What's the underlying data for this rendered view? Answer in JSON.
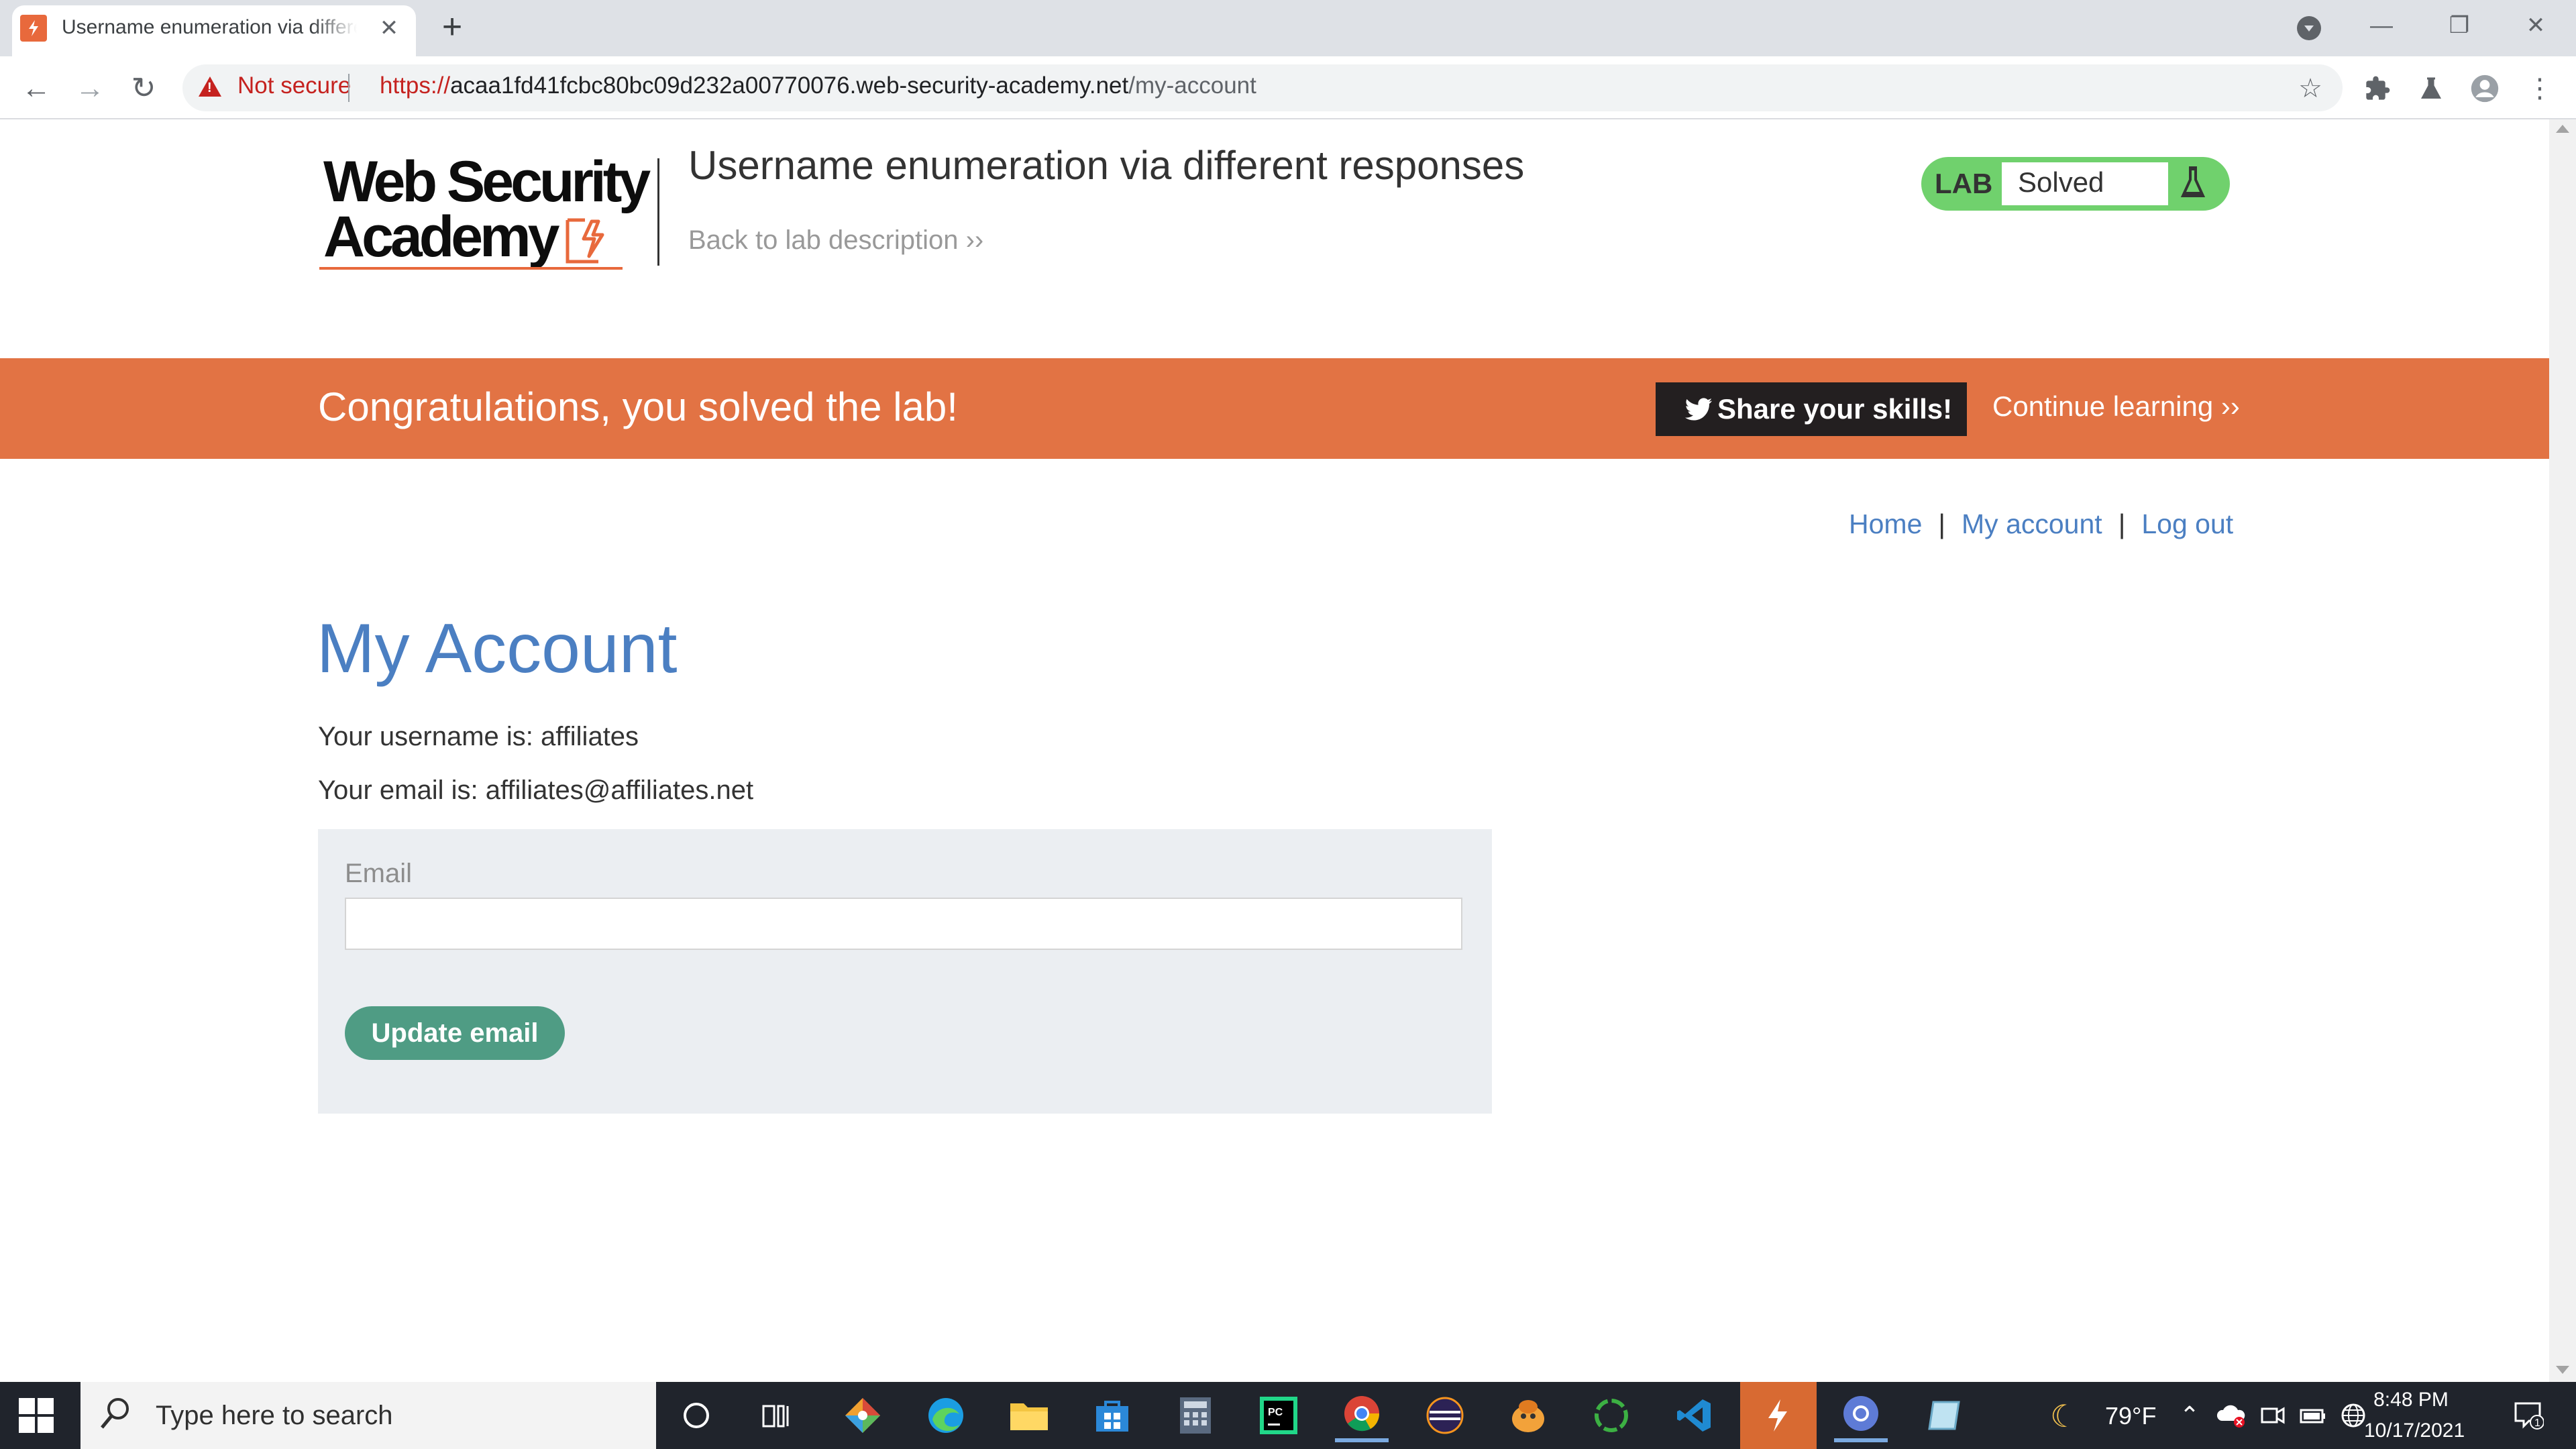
{
  "browser": {
    "tab_title": "Username enumeration via different responses",
    "tab_close": "✕",
    "new_tab": "+",
    "window_controls": {
      "minimize": "—",
      "restore": "❐",
      "close": "✕"
    },
    "security_label": "Not secure",
    "url_scheme": "https://",
    "url_host": "acaa1fd41fcbc80bc09d232a00770076.web-security-academy.net",
    "url_path": "/my-account"
  },
  "header": {
    "logo_line1": "Web Security",
    "logo_line2": "Academy",
    "lab_title": "Username enumeration via different responses",
    "back_link": "Back to lab description",
    "lab_badge_label": "LAB",
    "lab_status": "Solved"
  },
  "banner": {
    "message": "Congratulations, you solved the lab!",
    "share_label": "Share your skills!",
    "continue_label": "Continue learning"
  },
  "nav": {
    "home": "Home",
    "my_account": "My account",
    "log_out": "Log out",
    "separator": "|"
  },
  "account": {
    "heading": "My Account",
    "username_text": "Your username is: affiliates",
    "email_text": "Your email is: affiliates@affiliates.net",
    "email_label": "Email",
    "email_value": "",
    "update_button": "Update email"
  },
  "taskbar": {
    "search_placeholder": "Type here to search",
    "temperature": "79°F",
    "time": "8:48 PM",
    "date": "10/17/2021",
    "notification_count": "1"
  },
  "colors": {
    "accent_orange": "#e27344",
    "link_blue": "#4b7fc2",
    "solved_green": "#70d16d",
    "button_green": "#4f9c84",
    "insecure_red": "#c5221f"
  }
}
